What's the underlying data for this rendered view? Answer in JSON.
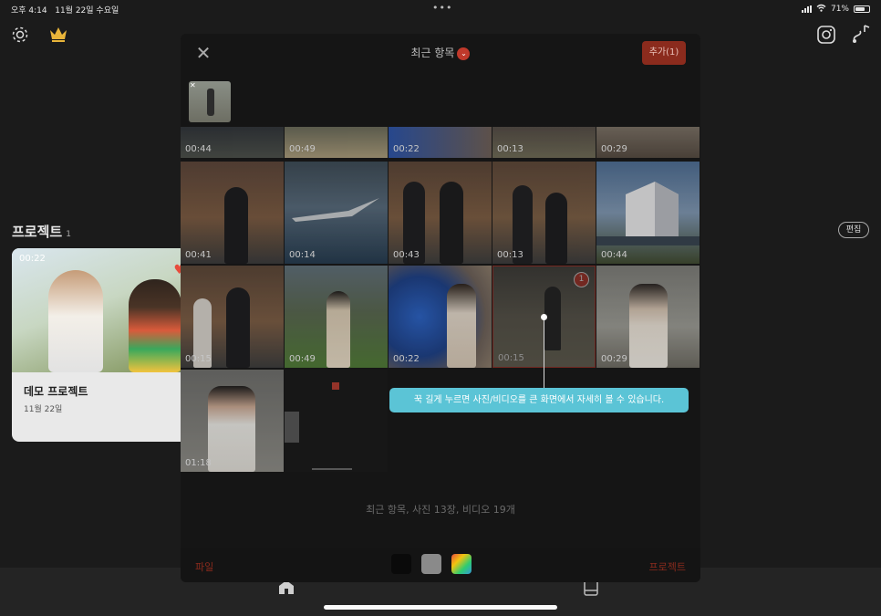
{
  "status": {
    "time": "오후 4:14",
    "date": "11월 22일 수요일",
    "battery": "71%",
    "battery_level": 0.71
  },
  "app": {
    "settings_icon": "gear-icon",
    "premium_icon": "crown-icon",
    "instagram_icon": "instagram-icon",
    "music_icon": "music-note-icon",
    "projects_title": "프로젝트",
    "projects_count": "1",
    "edit_label": "편집",
    "demo": {
      "duration": "00:22",
      "name": "데모 프로젝트",
      "date": "11월 22일"
    }
  },
  "picker": {
    "title": "최근 항목",
    "add_label": "추가(1)",
    "summary": "최근 항목, 사진 13장, 비디오 19개",
    "tooltip": "꾹 길게 누르면 사진/비디오를 큰 화면에서 자세히 볼 수 있습니다.",
    "file_label": "파일",
    "project_label": "프로젝트",
    "selected_badge": "1",
    "swatches": [
      "#0a0a0a",
      "#8a8a8a",
      "multicolor"
    ],
    "row0": [
      "00:44",
      "00:49",
      "00:22",
      "00:13",
      "00:29"
    ],
    "row1": [
      "00:41",
      "00:14",
      "00:43",
      "00:13",
      "00:44"
    ],
    "row2": [
      "00:15",
      "00:49",
      "00:22",
      "00:15",
      "00:29"
    ],
    "row3": [
      "01:18"
    ]
  },
  "colors": {
    "accent": "#c0392b",
    "tooltip": "#5bc4d6"
  }
}
